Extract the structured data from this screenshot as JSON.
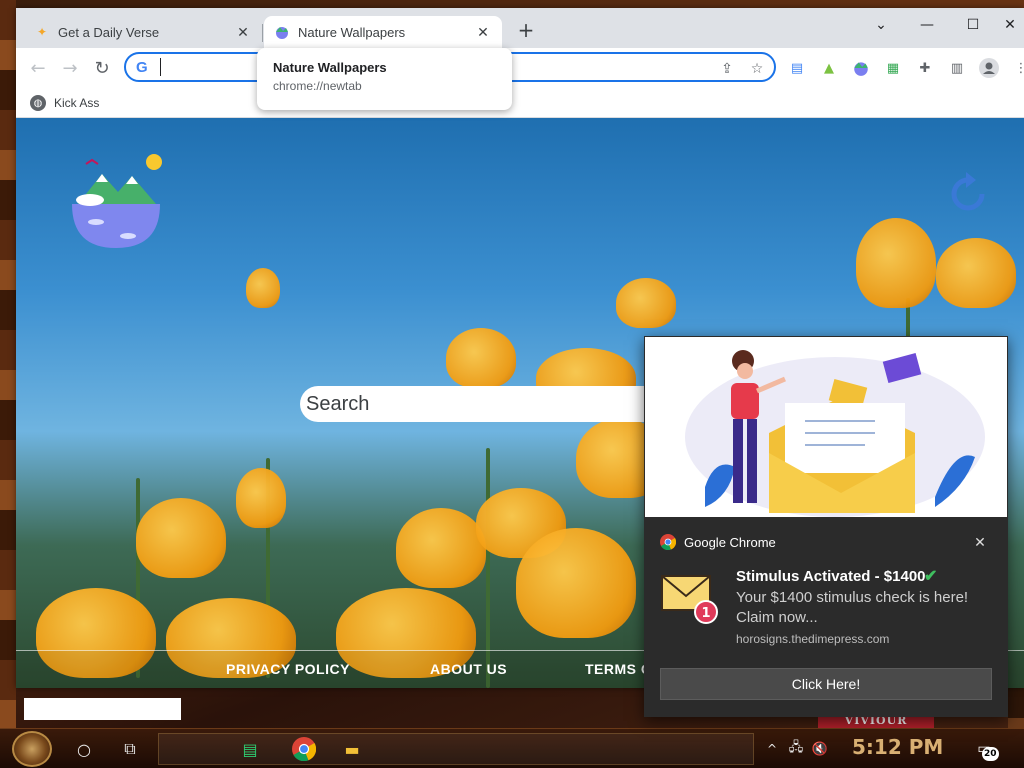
{
  "tabs": [
    {
      "title": "Get a Daily Verse",
      "favicon": "star-icon"
    },
    {
      "title": "Nature Wallpapers",
      "favicon": "nature-icon"
    }
  ],
  "hovercard": {
    "title": "Nature Wallpapers",
    "url": "chrome://newtab"
  },
  "bookmarks": [
    {
      "label": "Kick Ass"
    }
  ],
  "page": {
    "search_placeholder": "Search",
    "footer_links": [
      "PRIVACY POLICY",
      "ABOUT US",
      "TERMS O"
    ]
  },
  "notification": {
    "app": "Google Chrome",
    "title": "Stimulus Activated - $1400",
    "body": "Your $1400 stimulus check is here! Claim now...",
    "source": "horosigns.thedimepress.com",
    "button": "Click Here!",
    "badge_count": "1"
  },
  "taskbar": {
    "clock": "5:12 PM",
    "notification_count": "20"
  },
  "colors": {
    "accent": "#1a73e8",
    "toast_bg": "#2b2b2b",
    "check": "#3fbf5f"
  }
}
